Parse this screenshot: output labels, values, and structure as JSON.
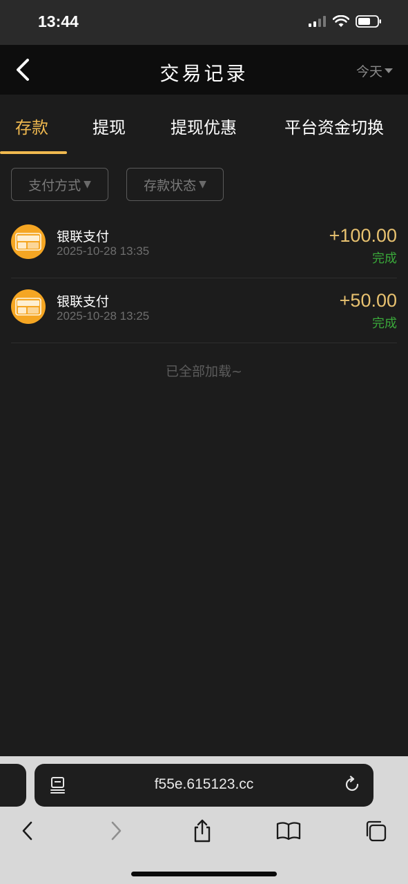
{
  "status_bar": {
    "time": "13:44"
  },
  "nav": {
    "title": "交易记录",
    "date_filter": "今天"
  },
  "tabs": [
    {
      "label": "存款",
      "active": true
    },
    {
      "label": "提现",
      "active": false
    },
    {
      "label": "提现优惠",
      "active": false
    },
    {
      "label": "平台资金切换",
      "active": false
    }
  ],
  "filters": {
    "payment_method": "支付方式",
    "deposit_status": "存款状态"
  },
  "records": [
    {
      "method": "银联支付",
      "time": "2025-10-28 13:35",
      "amount": "+100.00",
      "status": "完成"
    },
    {
      "method": "银联支付",
      "time": "2025-10-28 13:25",
      "amount": "+50.00",
      "status": "完成"
    }
  ],
  "list_footer": "已全部加载~",
  "browser": {
    "url": "f55e.615123.cc"
  },
  "icons": {
    "back": "chevron-left-icon",
    "reader": "reader-mode-icon",
    "reload": "reload-icon",
    "share": "share-icon",
    "bookmarks": "book-icon",
    "tabs": "tabs-icon",
    "payment": "unionpay-icon"
  },
  "colors": {
    "accent": "#f0b94f",
    "amount": "#e8c270",
    "success": "#3aa83a",
    "payment_icon_bg": "#f5a623"
  }
}
